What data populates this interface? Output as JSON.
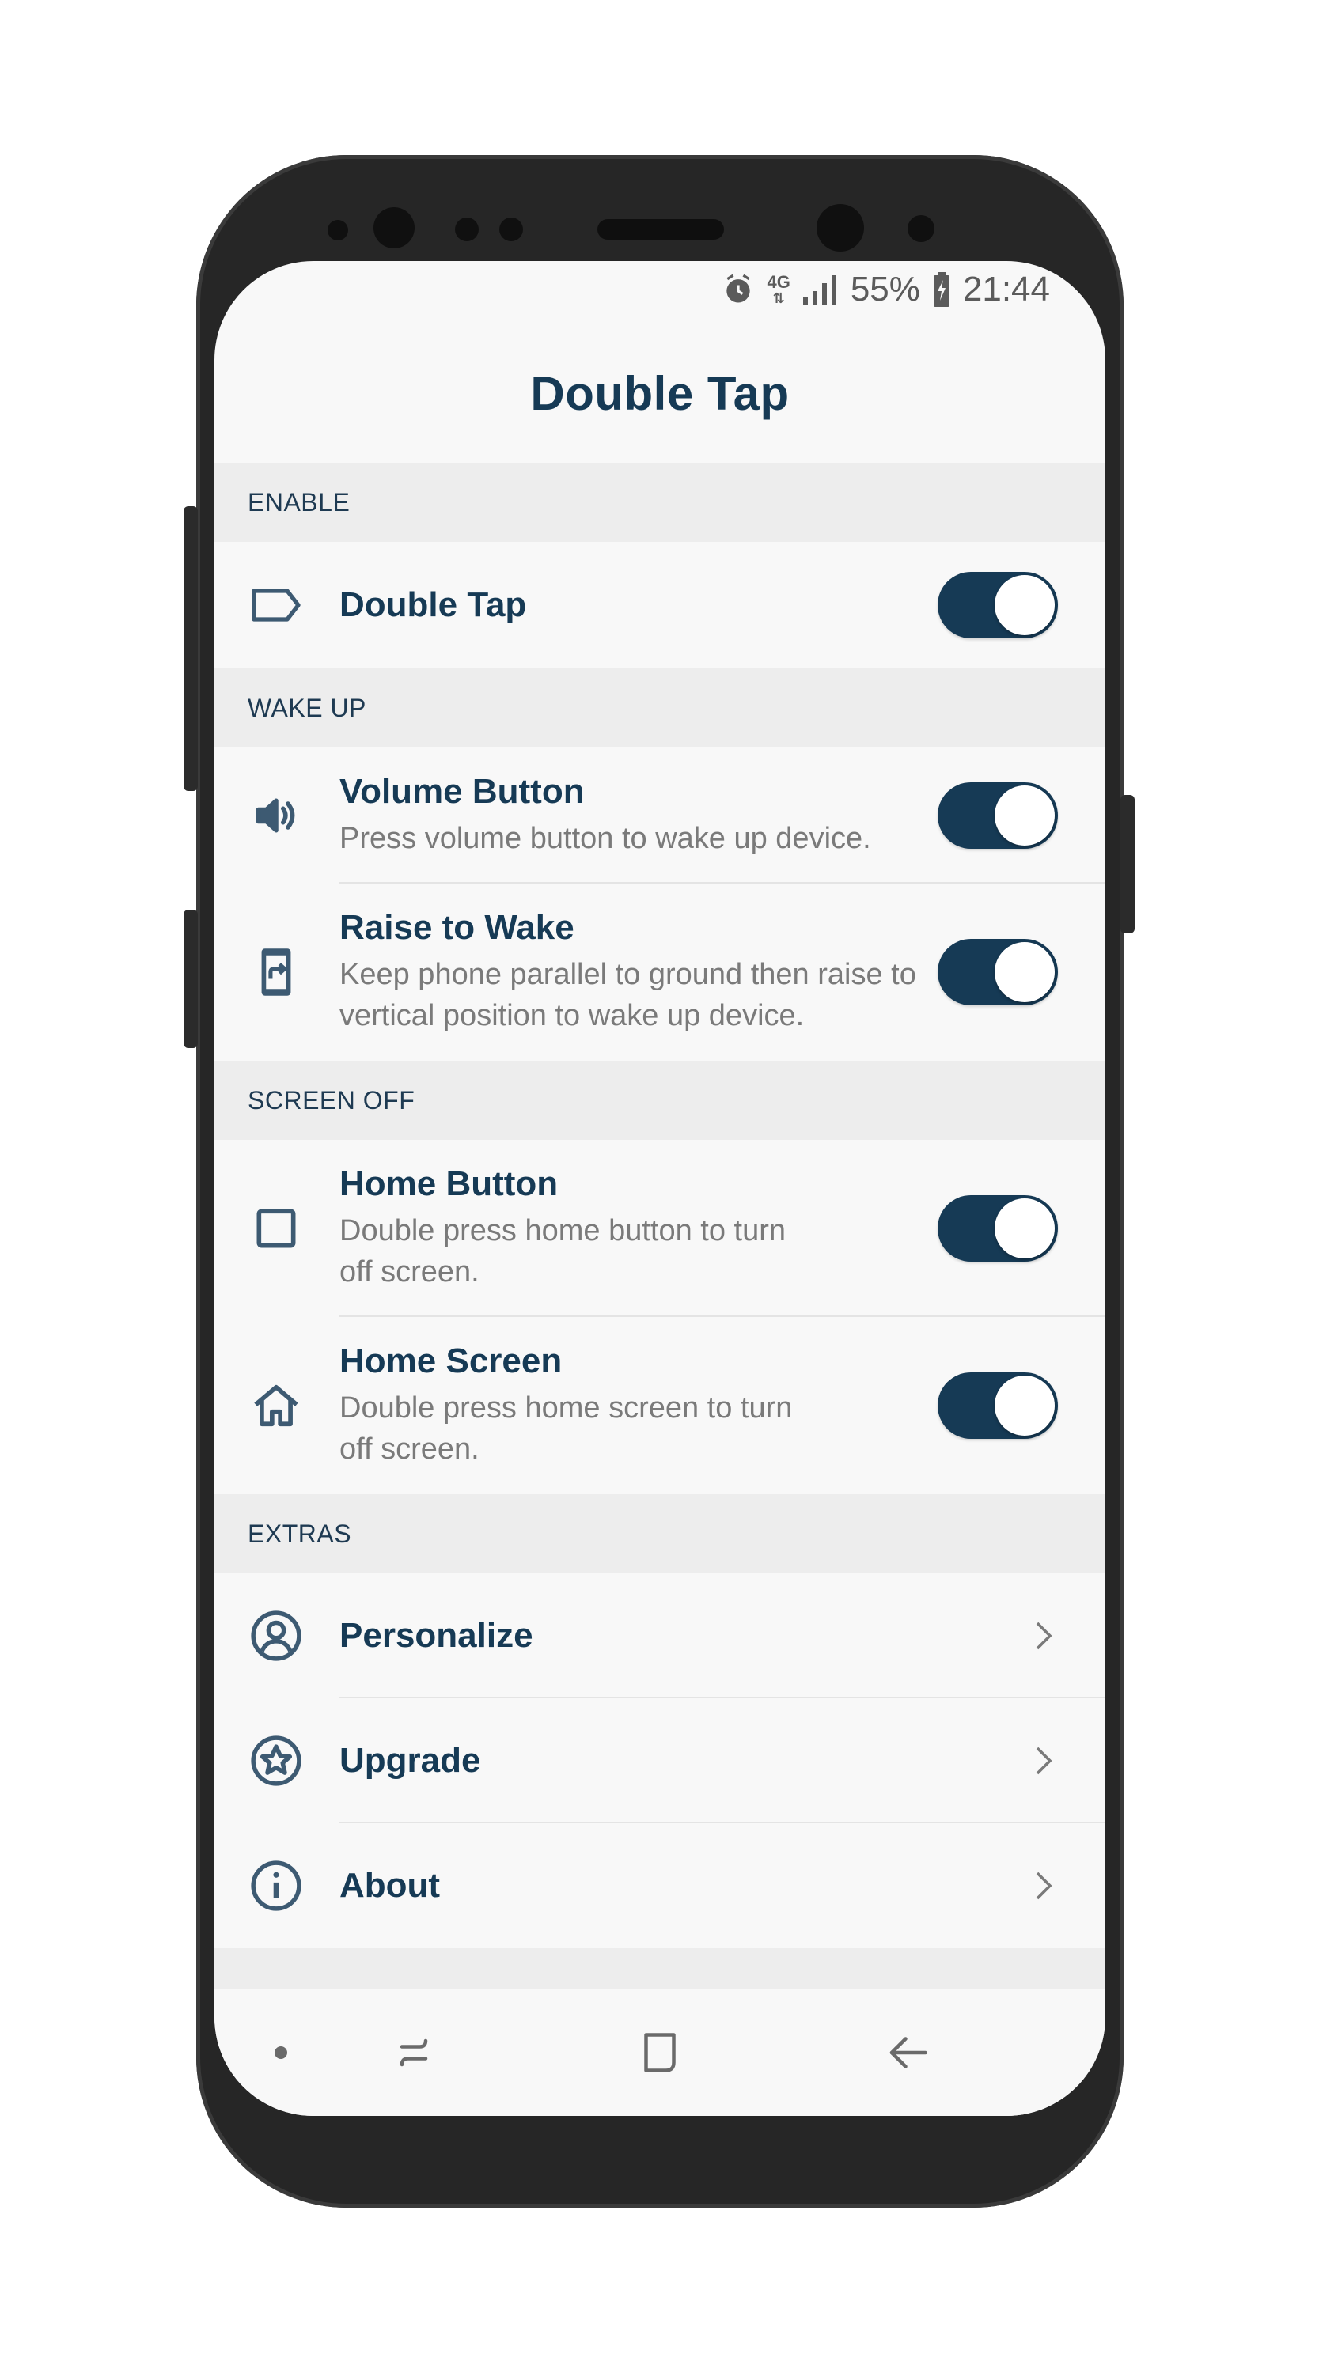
{
  "status_bar": {
    "network": "4G",
    "battery": "55%",
    "time": "21:44"
  },
  "app_bar": {
    "title": "Double Tap"
  },
  "sections": {
    "enable": {
      "header": "ENABLE",
      "double_tap": {
        "title": "Double Tap",
        "enabled": true
      }
    },
    "wake_up": {
      "header": "WAKE UP",
      "volume_button": {
        "title": "Volume Button",
        "description": "Press volume button to wake up device.",
        "enabled": true
      },
      "raise_to_wake": {
        "title": "Raise to Wake",
        "description": "Keep phone parallel to ground then raise to vertical position to wake up device.",
        "enabled": true
      }
    },
    "screen_off": {
      "header": "SCREEN OFF",
      "home_button": {
        "title": "Home Button",
        "description": "Double press home button to turn off screen.",
        "enabled": true
      },
      "home_screen": {
        "title": "Home Screen",
        "description": "Double press home screen to turn off screen.",
        "enabled": true
      }
    },
    "extras": {
      "header": "EXTRAS",
      "personalize": {
        "title": "Personalize"
      },
      "upgrade": {
        "title": "Upgrade"
      },
      "about": {
        "title": "About"
      }
    }
  },
  "icons": {
    "double_tap": "label-tag-icon",
    "volume_button": "volume-icon",
    "raise_to_wake": "phone-rotate-icon",
    "home_button": "square-icon",
    "home_screen": "home-icon",
    "personalize": "account-circle-icon",
    "upgrade": "star-circle-icon",
    "about": "info-icon"
  },
  "colors": {
    "accent": "#163a55",
    "icon": "#3d5a72",
    "section_bg": "#ededed",
    "background": "#f8f8f8"
  }
}
